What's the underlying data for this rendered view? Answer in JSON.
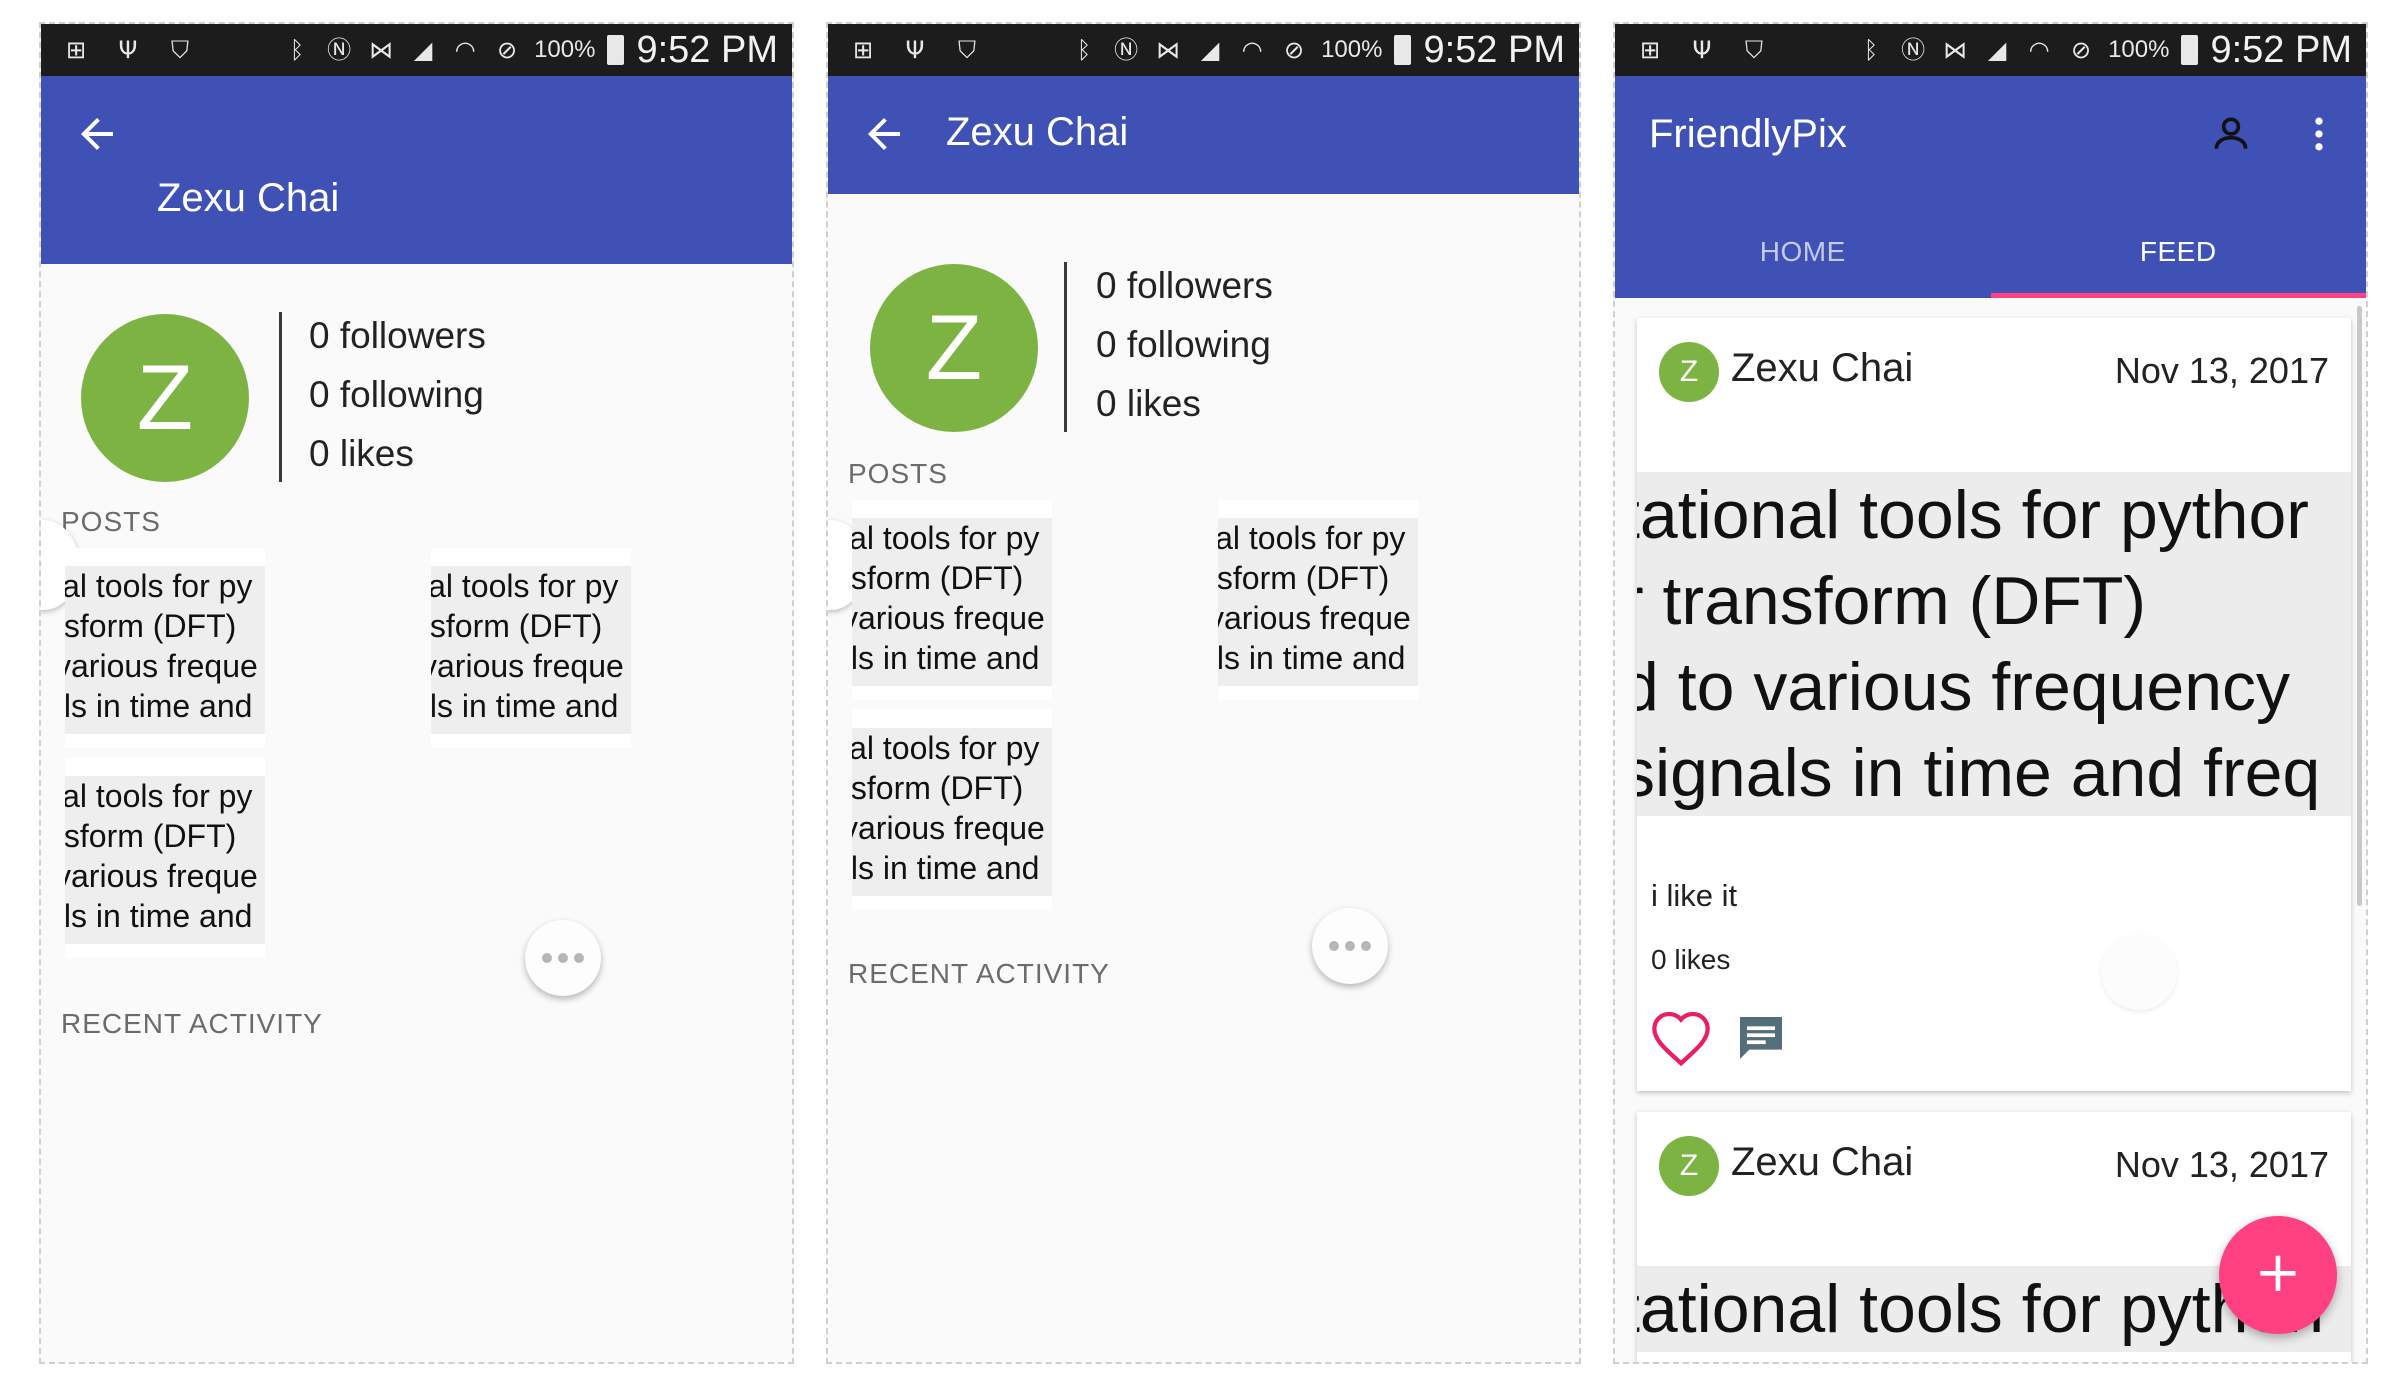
{
  "status_bar": {
    "battery": "100%",
    "time": "9:52 PM"
  },
  "profile": {
    "name": "Zexu Chai",
    "avatar_letter": "Z",
    "followers": "0 followers",
    "following": "0 following",
    "likes": "0 likes"
  },
  "sections": {
    "posts": "POSTS",
    "recent_activity": "RECENT ACTIVITY"
  },
  "thumb_text": {
    "line1": "ial tools for py",
    "line2": "ısform (DFT)",
    "line3": "various freque",
    "line4": "ıls in time and"
  },
  "app": {
    "title": "FriendlyPix"
  },
  "tabs": [
    {
      "label": "HOME"
    },
    {
      "label": "FEED"
    }
  ],
  "feed": {
    "posts": [
      {
        "author": "Zexu Chai",
        "avatar_letter": "Z",
        "date": "Nov 13, 2017",
        "image_lines": [
          "tational tools for pythor",
          "r transform (DFT)",
          "d to various frequency",
          "signals in time and freq"
        ],
        "caption": "i like it",
        "likes": "0 likes"
      },
      {
        "author": "Zexu Chai",
        "avatar_letter": "Z",
        "date": "Nov 13, 2017",
        "image_lines": [
          "tational tools for python"
        ]
      }
    ],
    "fab_label": "+"
  },
  "icons": {
    "back": "arrow-left-icon",
    "account": "account-icon",
    "overflow": "more-vert-icon",
    "heart": "heart-outline-icon",
    "comment": "comment-icon"
  },
  "colors": {
    "primary": "#3f51b5",
    "accent": "#ff4081",
    "avatar": "#7cb342",
    "heart": "#e91e63",
    "comment_icon": "#546e7a"
  }
}
